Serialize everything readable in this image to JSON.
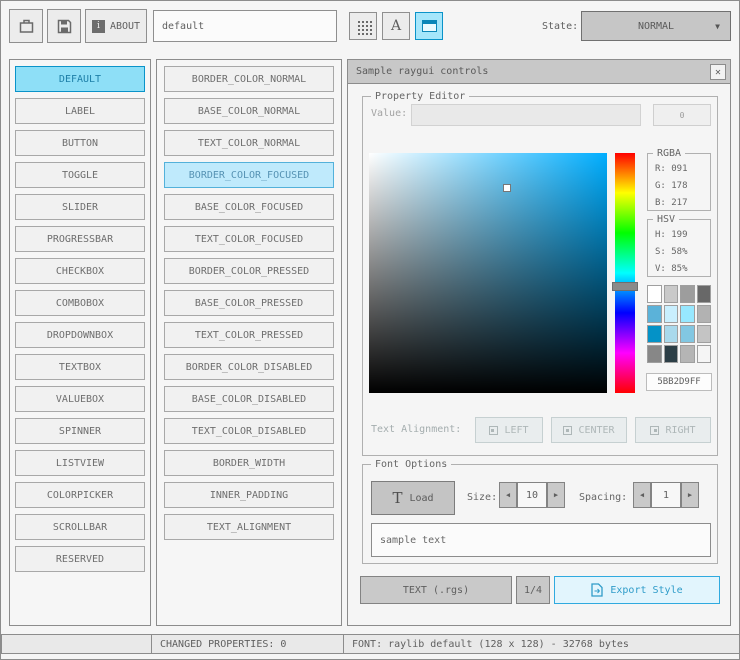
{
  "toolbar": {
    "about_label": "ABOUT",
    "style_name_value": "default",
    "state_label": "State:",
    "state_value": "NORMAL"
  },
  "icons": {
    "about_info": "i",
    "font_letter": "A",
    "dropdown_arrow": "▼",
    "close": "✕",
    "spinner_left": "◀",
    "spinner_right": "▶",
    "load_t": "T"
  },
  "controls_list": [
    "DEFAULT",
    "LABEL",
    "BUTTON",
    "TOGGLE",
    "SLIDER",
    "PROGRESSBAR",
    "CHECKBOX",
    "COMBOBOX",
    "DROPDOWNBOX",
    "TEXTBOX",
    "VALUEBOX",
    "SPINNER",
    "LISTVIEW",
    "COLORPICKER",
    "SCROLLBAR",
    "RESERVED"
  ],
  "properties_list": [
    "BORDER_COLOR_NORMAL",
    "BASE_COLOR_NORMAL",
    "TEXT_COLOR_NORMAL",
    "BORDER_COLOR_FOCUSED",
    "BASE_COLOR_FOCUSED",
    "TEXT_COLOR_FOCUSED",
    "BORDER_COLOR_PRESSED",
    "BASE_COLOR_PRESSED",
    "TEXT_COLOR_PRESSED",
    "BORDER_COLOR_DISABLED",
    "BASE_COLOR_DISABLED",
    "TEXT_COLOR_DISABLED",
    "BORDER_WIDTH",
    "INNER_PADDING",
    "TEXT_ALIGNMENT"
  ],
  "selection": {
    "control": "DEFAULT",
    "property": "BORDER_COLOR_FOCUSED",
    "state": "NORMAL"
  },
  "sample_window": {
    "title": "Sample raygui controls"
  },
  "property_editor": {
    "title": "Property Editor",
    "value_label": "Value:",
    "value_text": "",
    "value_button_label": "0",
    "rgba_title": "RGBA",
    "rgba_r": "R: 091",
    "rgba_g": "G: 178",
    "rgba_b": "B: 217",
    "hsv_title": "HSV",
    "hsv_h": "H: 199",
    "hsv_s": "S: 58%",
    "hsv_v": "V: 85%",
    "hex_value": "5BB2D9FF",
    "alignment_label": "Text Alignment:",
    "align_left": "LEFT",
    "align_center": "CENTER",
    "align_right": "RIGHT"
  },
  "font_options": {
    "title": "Font Options",
    "load_label": "Load",
    "size_label": "Size:",
    "size_value": "10",
    "spacing_label": "Spacing:",
    "spacing_value": "1",
    "sample_text": "sample text"
  },
  "export_bar": {
    "format_button": "TEXT (.rgs)",
    "pager": "1/4",
    "export_button": "Export Style"
  },
  "statusbar": {
    "changed_properties": "CHANGED PROPERTIES: 0",
    "font_info": "FONT: raylib default (128 x 128) - 32768 bytes"
  },
  "colors": {
    "selected_color": "#5BB2D9",
    "hue_pure": "#00AEFF",
    "accent_border": "#0492C7",
    "accent_fill": "#97E8FF"
  },
  "palette": [
    "#ffffff",
    "#c9c9c9",
    "#9d9d9d",
    "#686868",
    "#5bb2d9",
    "#c9effe",
    "#97e8ff",
    "#b2b2b2",
    "#0492c7",
    "#a9d9ec",
    "#82c7e2",
    "#c4c4c4",
    "#878787",
    "#2c3e46",
    "#b5b5b5",
    "#f5f5f5"
  ]
}
